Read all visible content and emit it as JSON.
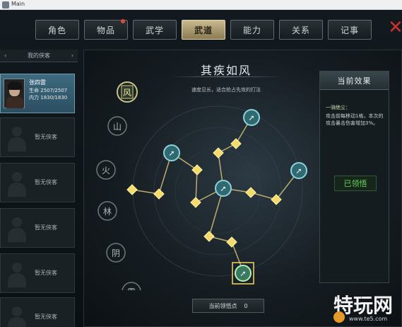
{
  "window": {
    "title": "Main"
  },
  "tabs": [
    {
      "label": "角色",
      "active": false,
      "badge": false
    },
    {
      "label": "物品",
      "active": false,
      "badge": true
    },
    {
      "label": "武学",
      "active": false,
      "badge": false
    },
    {
      "label": "武道",
      "active": true,
      "badge": false
    },
    {
      "label": "能力",
      "active": false,
      "badge": false
    },
    {
      "label": "关系",
      "active": false,
      "badge": false
    },
    {
      "label": "记事",
      "active": false,
      "badge": false
    }
  ],
  "left": {
    "header": "我的侠客",
    "character": {
      "name": "张四雷",
      "hp_label": "生命",
      "hp_value": "2507/2507",
      "mp_label": "内力",
      "mp_value": "1830/1830"
    },
    "empty_label": "暂无侠客"
  },
  "main": {
    "title": "其疾如风",
    "desc": "速度见长，适合抢占先攻的打法",
    "glyphs": [
      "风",
      "山",
      "火",
      "林",
      "阴",
      "雷"
    ],
    "points_label": "当前领悟点",
    "points_value": "0"
  },
  "effect": {
    "title": "当前效果",
    "subtitle": "一骑绝尘：",
    "text": "攻击前每移动1格，本次的攻击暴击伤害增加3%。",
    "state": "已领悟"
  },
  "watermark": {
    "brand": "特玩网",
    "url": "www.te5.com"
  },
  "colors": {
    "accent": "#e8c85a",
    "effect_active": "#62d65a",
    "close": "#c8322b"
  }
}
